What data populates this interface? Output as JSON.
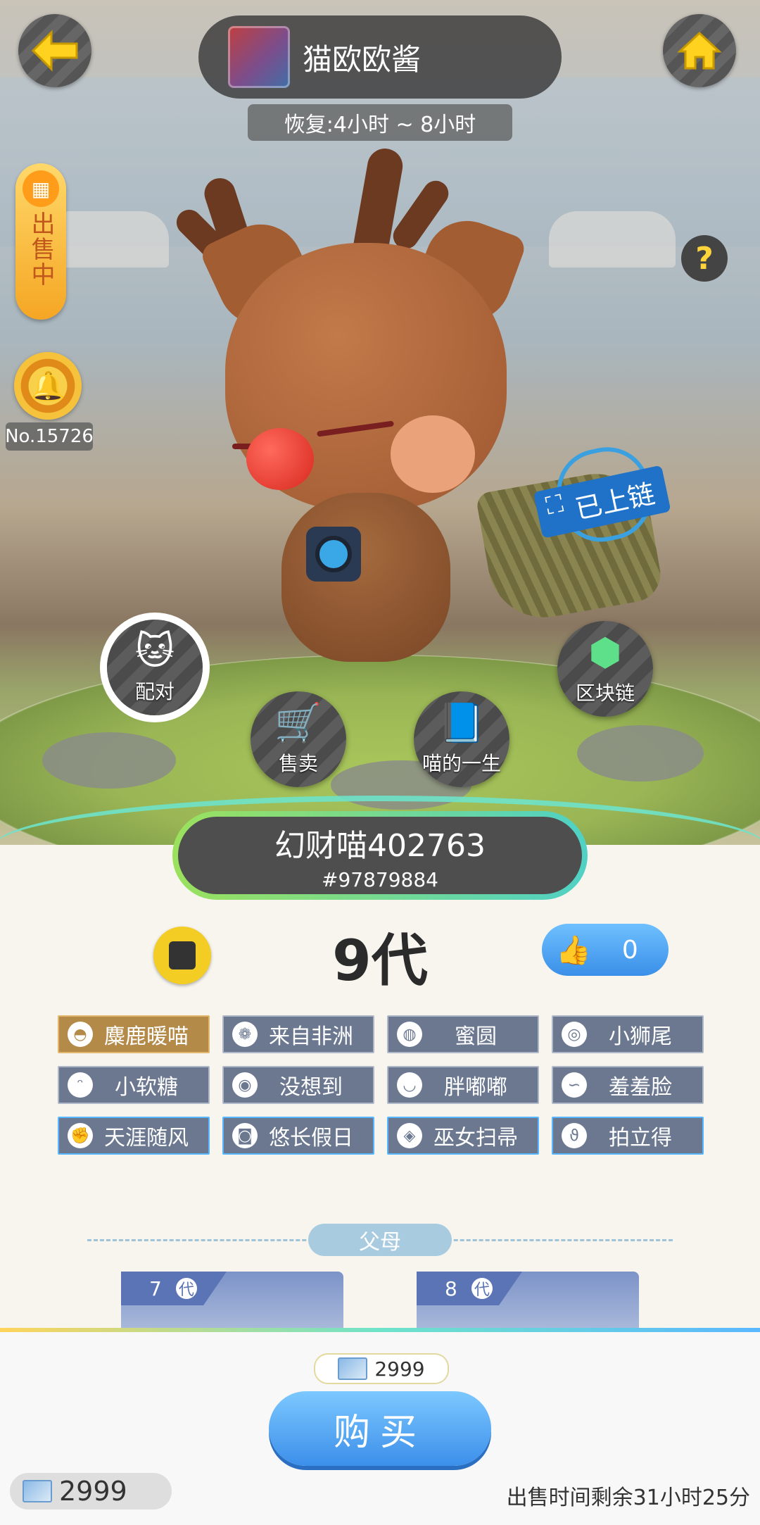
{
  "header": {
    "owner_name": "猫欧欧酱",
    "recover": "恢复:4小时 ~ 8小时"
  },
  "sidebar": {
    "sale_status": "出售中",
    "cat_number": "No.15726"
  },
  "chain_badge": "已上链",
  "actions": {
    "pair": "配对",
    "sell": "售卖",
    "life": "喵的一生",
    "blockchain": "区块链"
  },
  "cat": {
    "name": "幻财喵402763",
    "id": "#97879884",
    "generation": "9代",
    "likes": "0"
  },
  "tags": [
    {
      "label": "麋鹿暖喵",
      "icon": "hat-icon",
      "style": "gold"
    },
    {
      "label": "来自非洲",
      "icon": "paw-icon",
      "style": "gray"
    },
    {
      "label": "蜜圆",
      "icon": "egg-icon",
      "style": "gray"
    },
    {
      "label": "小狮尾",
      "icon": "swirl-icon",
      "style": "gray"
    },
    {
      "label": "小软糖",
      "icon": "cat-face-icon",
      "style": "gray"
    },
    {
      "label": "没想到",
      "icon": "eye-icon",
      "style": "gray"
    },
    {
      "label": "胖嘟嘟",
      "icon": "lips-icon",
      "style": "gray"
    },
    {
      "label": "羞羞脸",
      "icon": "mustache-icon",
      "style": "gray"
    },
    {
      "label": "天涯随风",
      "icon": "arm-icon",
      "style": "blue"
    },
    {
      "label": "悠长假日",
      "icon": "sunglasses-icon",
      "style": "blue"
    },
    {
      "label": "巫女扫帚",
      "icon": "cat-badge-icon",
      "style": "blue"
    },
    {
      "label": "拍立得",
      "icon": "tail-icon",
      "style": "blue"
    }
  ],
  "parents": {
    "label": "父母",
    "cards": [
      {
        "generation": "7",
        "unit": "代"
      },
      {
        "generation": "8",
        "unit": "代"
      }
    ]
  },
  "purchase": {
    "price": "2999",
    "buy_label": "购买",
    "wallet_balance": "2999",
    "remaining": "出售时间剩余31小时25分"
  },
  "colors": {
    "accent": "#3c8fea",
    "tag_gray": "#6b7890",
    "tag_gold": "#b48a48",
    "name_border": "#9be15d"
  }
}
